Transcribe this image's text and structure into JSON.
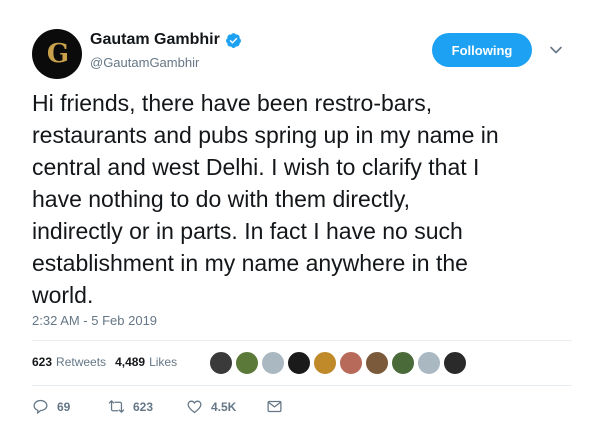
{
  "tweet": {
    "author": {
      "display_name": "Gautam Gambhir",
      "handle": "@GautamGambhir",
      "verified": true,
      "avatar_monogram": "G"
    },
    "follow_button_label": "Following",
    "text": "Hi friends, there have been restro-bars,\nrestaurants and pubs spring up in my name in\ncentral and west Delhi. I wish to clarify that I\nhave nothing to do with them directly,\nindirectly or in parts. In fact I have no such\nestablishment in my name anywhere in the\nworld.",
    "timestamp": "2:32 AM - 5 Feb 2019",
    "stats": {
      "retweets_count": "623",
      "retweets_label": "Retweets",
      "likes_count": "4,489",
      "likes_label": "Likes"
    },
    "liker_avatar_colors": [
      "#3a3a3a",
      "#5b7a3a",
      "#aab8c2",
      "#1a1a1a",
      "#c08a2a",
      "#b86a5a",
      "#7a5a3a",
      "#4a6a3a",
      "#aab8c2",
      "#2a2a2a"
    ],
    "actions": {
      "reply_count": "69",
      "retweet_count": "623",
      "like_count": "4.5K"
    }
  },
  "colors": {
    "accent": "#1da1f2",
    "muted_text": "#657786",
    "divider": "#e6ecf0"
  },
  "icons": {
    "verified": "verified-badge-icon",
    "caret": "chevron-down-icon",
    "reply": "reply-icon",
    "retweet": "retweet-icon",
    "like": "heart-icon",
    "message": "envelope-icon"
  }
}
